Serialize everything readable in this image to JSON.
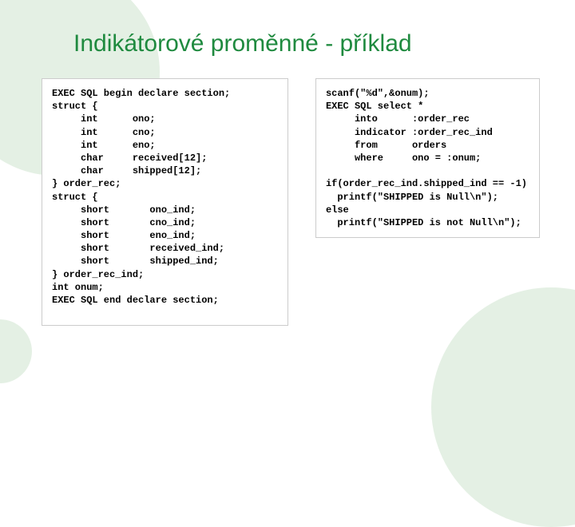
{
  "title": "Indikátorové proměnné - příklad",
  "code_left": "EXEC SQL begin declare section;\nstruct {\n     int      ono;\n     int      cno;\n     int      eno;\n     char     received[12];\n     char     shipped[12];\n} order_rec;\nstruct {\n     short       ono_ind;\n     short       cno_ind;\n     short       eno_ind;\n     short       received_ind;\n     short       shipped_ind;\n} order_rec_ind;\nint onum;\nEXEC SQL end declare section;",
  "code_right": "scanf(\"%d\",&onum);\nEXEC SQL select *\n     into      :order_rec\n     indicator :order_rec_ind\n     from      orders\n     where     ono = :onum;\n\nif(order_rec_ind.shipped_ind == -1)\n  printf(\"SHIPPED is Null\\n\");\nelse\n  printf(\"SHIPPED is not Null\\n\");"
}
